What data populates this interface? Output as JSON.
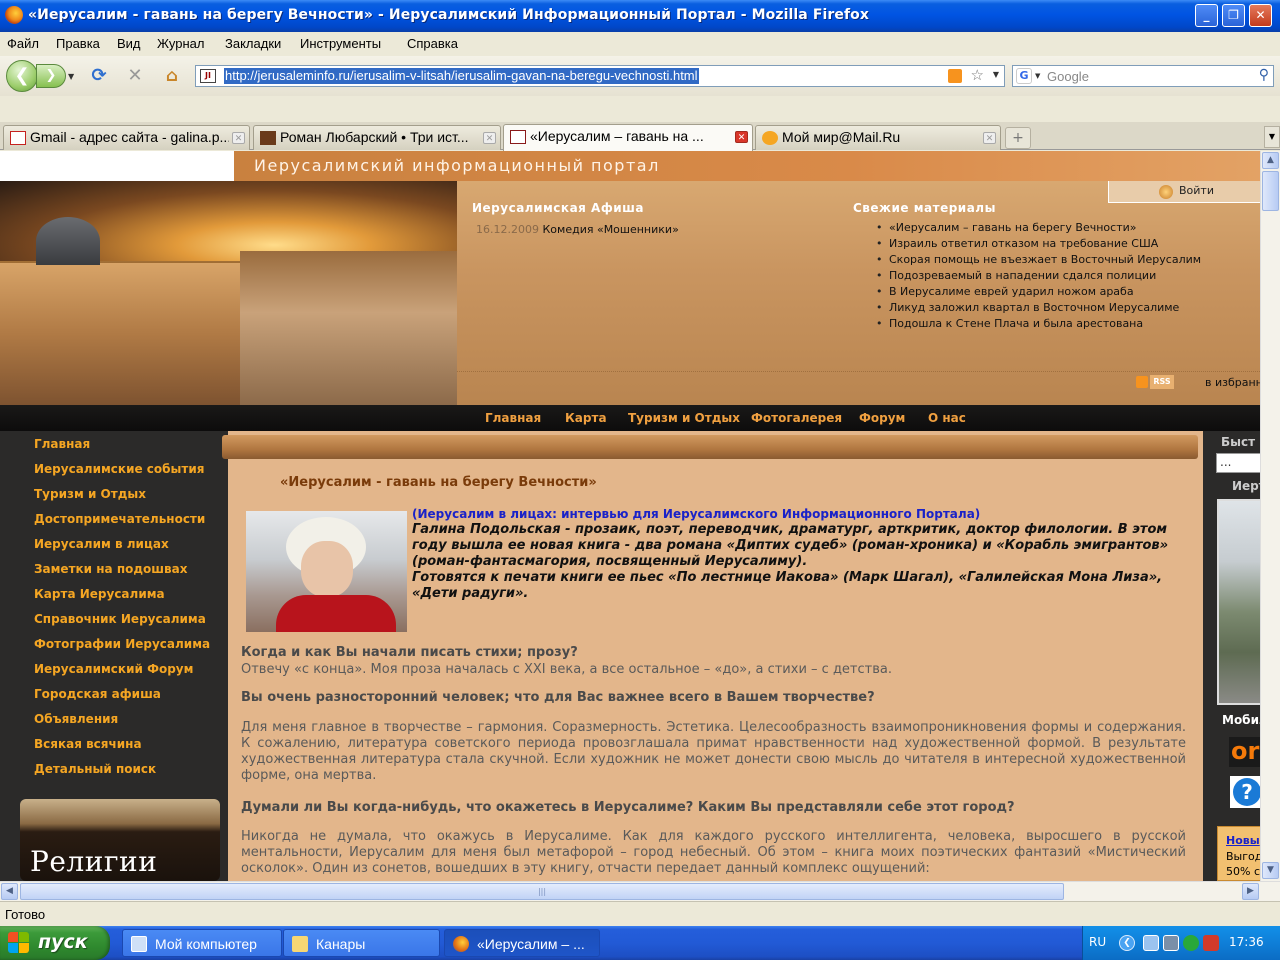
{
  "window": {
    "title": "«Иерусалим - гавань на берегу Вечности» - Иерусалимский Информационный Портал - Mozilla Firefox",
    "minimize": "_",
    "maximize": "❐",
    "close": "✕"
  },
  "menu": [
    "Файл",
    "Правка",
    "Вид",
    "Журнал",
    "Закладки",
    "Инструменты",
    "Справка"
  ],
  "navbar": {
    "url": "http://jerusaleminfo.ru/ierusalim-v-litsah/ierusalim-gavan-na-beregu-vechnosti.html",
    "search_placeholder": "Google",
    "favicon_text": "JI"
  },
  "tabs": [
    {
      "label": "Gmail - адрес сайта - galina.p...",
      "active": false,
      "icon_color": "#c5221f"
    },
    {
      "label": "Роман Любарский • Три ист...",
      "active": false,
      "icon_color": "#6a3a1a"
    },
    {
      "label": "«Иерусалим – гавань на ...",
      "active": true,
      "icon_color": "#8a1a1a"
    },
    {
      "label": "Мой мир@Mail.Ru",
      "active": false,
      "icon_color": "#f5a623"
    }
  ],
  "header": {
    "portal_title": "Иерусалимский информационный портал",
    "login": "Войти",
    "afisha_title": "Иерусалимская Афиша",
    "afisha_items": [
      {
        "date": "16.12.2009",
        "event": "Комедия «Мошенники»"
      }
    ],
    "fresh_title": "Свежие материалы",
    "fresh_items": [
      "«Иерусалим – гавань на берегу Вечности»",
      "Израиль ответил отказом на требование США",
      "Скорая помощь не въезжает в Восточный Иерусалим",
      "Подозреваемый в нападении сдался полиции",
      "В Иерусалиме еврей ударил ножом араба",
      "Ликуд заложил квартал в Восточном Иерусалиме",
      "Подошла к Стене Плача и была арестована"
    ],
    "rss": "RSS",
    "favorites": "в избранно"
  },
  "topnav": [
    "Главная",
    "Карта",
    "Туризм и Отдых",
    "Фотогалерея",
    "Форум",
    "О нас"
  ],
  "sidebar": {
    "items": [
      "Главная",
      "Иерусалимские события",
      "Туризм и Отдых",
      "Достопримечательности",
      "Иерусалим в лицах",
      "Заметки на подошвах",
      "Карта Иерусалима",
      "Справочник Иерусалима",
      "Фотографии Иерусалима",
      "Иерусалимский Форум",
      "Городская афиша",
      "Объявления",
      "Всякая всячина",
      "Детальный поиск"
    ],
    "banner": "Религии Мира"
  },
  "article": {
    "title": "«Иерусалим - гавань на берегу Вечности»",
    "tag": "(Иерусалим в лицах: интервью для Иерусалимского Информационного Портала)",
    "intro1": "Галина Подольская - прозаик, поэт, переводчик, драматург, арткритик, доктор филологии. В этом году вышла ее новая книга - два романа «Диптих судеб» (роман-хроника) и «Корабль эмигрантов» (роман-фантасмагория, посвященный Иерусалиму).",
    "intro2": "Готовятся к печати книги ее пьес «По лестнице Иакова» (Марк Шагал), «Галилейская Мона Лиза», «Дети радуги».",
    "q1": "Когда и как Вы начали писать стихи; прозу?",
    "a1": "Отвечу «с конца». Моя проза началась с XXI века, а все остальное  – «до», а стихи – с детства.",
    "q2": "Вы очень разносторонний человек; что для Вас важнее всего в Вашем творчестве?",
    "a2": "Для меня главное в творчестве – гармония. Соразмерность. Эстетика. Целесообразность взаимопроникновения формы и содержания. К сожалению, литература советского периода провозглашала примат нравственности над художественной формой. В результате художественная литература стала скучной. Если художник не может донести свою мысль до читателя в интересной художественной форме, она мертва.",
    "q3": "Думали ли Вы когда-нибудь, что окажетесь в Иерусалиме? Каким Вы представляли себе этот город?",
    "a3": " Никогда не думала, что окажусь в Иерусалиме. Как для каждого русского интеллигента, человека, выросшего в русской ментальности, Иерусалим для меня был метафорой – город небесный. Об этом –  книга моих поэтических фантазий «Мистический осколок». Один из сонетов, вошедших в эту книгу, отчасти передает данный комплекс ощущений:"
  },
  "rightcol": {
    "label1": "Быст",
    "search_value": "...",
    "label2": "Иерт",
    "label3": "Мобил",
    "orb": "or",
    "promo_line1": "Новы",
    "promo_line2": "Выгод",
    "promo_line3": "50% с"
  },
  "status": "Готово",
  "taskbar": {
    "start": "пуск",
    "items": [
      {
        "label": "Мой компьютер",
        "active": false
      },
      {
        "label": "Канары",
        "active": false
      },
      {
        "label": "«Иерусалим – ...",
        "active": true
      }
    ],
    "lang": "RU",
    "clock": "17:36"
  }
}
